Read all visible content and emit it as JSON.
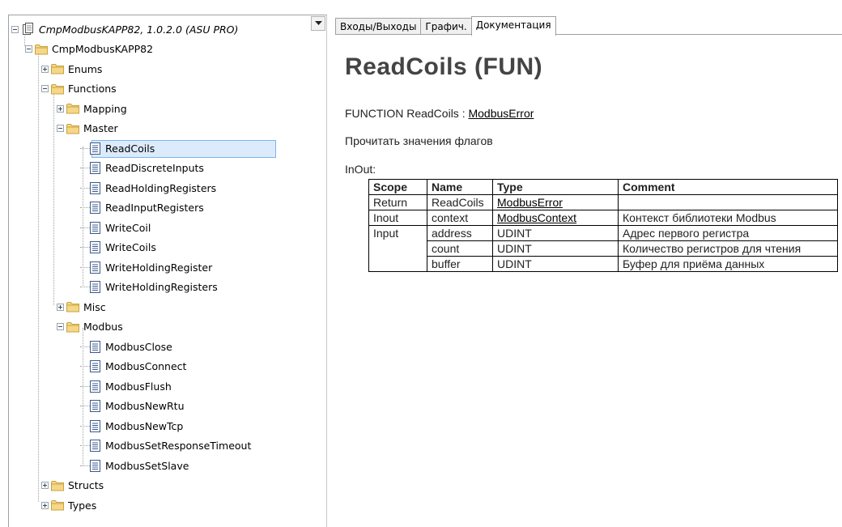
{
  "tree": {
    "root_label": "CmpModbusKAPP82, 1.0.2.0 (ASU PRO)",
    "library_label": "CmpModbusKAPP82",
    "enums": "Enums",
    "functions": "Functions",
    "mapping": "Mapping",
    "master": "Master",
    "master_items": [
      "ReadCoils",
      "ReadDiscreteInputs",
      "ReadHoldingRegisters",
      "ReadInputRegisters",
      "WriteCoil",
      "WriteCoils",
      "WriteHoldingRegister",
      "WriteHoldingRegisters"
    ],
    "misc": "Misc",
    "modbus": "Modbus",
    "modbus_items": [
      "ModbusClose",
      "ModbusConnect",
      "ModbusFlush",
      "ModbusNewRtu",
      "ModbusNewTcp",
      "ModbusSetResponseTimeout",
      "ModbusSetSlave"
    ],
    "structs": "Structs",
    "types": "Types",
    "selected": "ReadCoils"
  },
  "tabs": [
    "Входы/Выходы",
    "Графич.",
    "Документация"
  ],
  "active_tab": "Документация",
  "doc": {
    "title": "ReadCoils (FUN)",
    "signature_prefix": "FUNCTION ReadCoils : ",
    "signature_type": "ModbusError",
    "description": "Прочитать значения флагов",
    "inout_label": "InOut:",
    "table": {
      "headers": [
        "Scope",
        "Name",
        "Type",
        "Comment"
      ],
      "rows": [
        {
          "scope": "Return",
          "name": "ReadCoils",
          "type": "ModbusError",
          "type_link": true,
          "comment": ""
        },
        {
          "scope": "Inout",
          "name": "context",
          "type": "ModbusContext",
          "type_link": true,
          "comment": "Контекст библиотеки Modbus"
        },
        {
          "scope": "Input",
          "name": "address",
          "type": "UDINT",
          "type_link": false,
          "comment": "Адрес первого регистра"
        },
        {
          "scope": "",
          "name": "count",
          "type": "UDINT",
          "type_link": false,
          "comment": "Количество регистров для чтения"
        },
        {
          "scope": "",
          "name": "buffer",
          "type": "UDINT",
          "type_link": false,
          "comment": "Буфер для приёма данных"
        }
      ]
    }
  },
  "colors": {
    "folder": "#f5d78a",
    "selection_bg": "#dcebfc",
    "selection_border": "#7eb4ea",
    "title_text": "#444444"
  }
}
